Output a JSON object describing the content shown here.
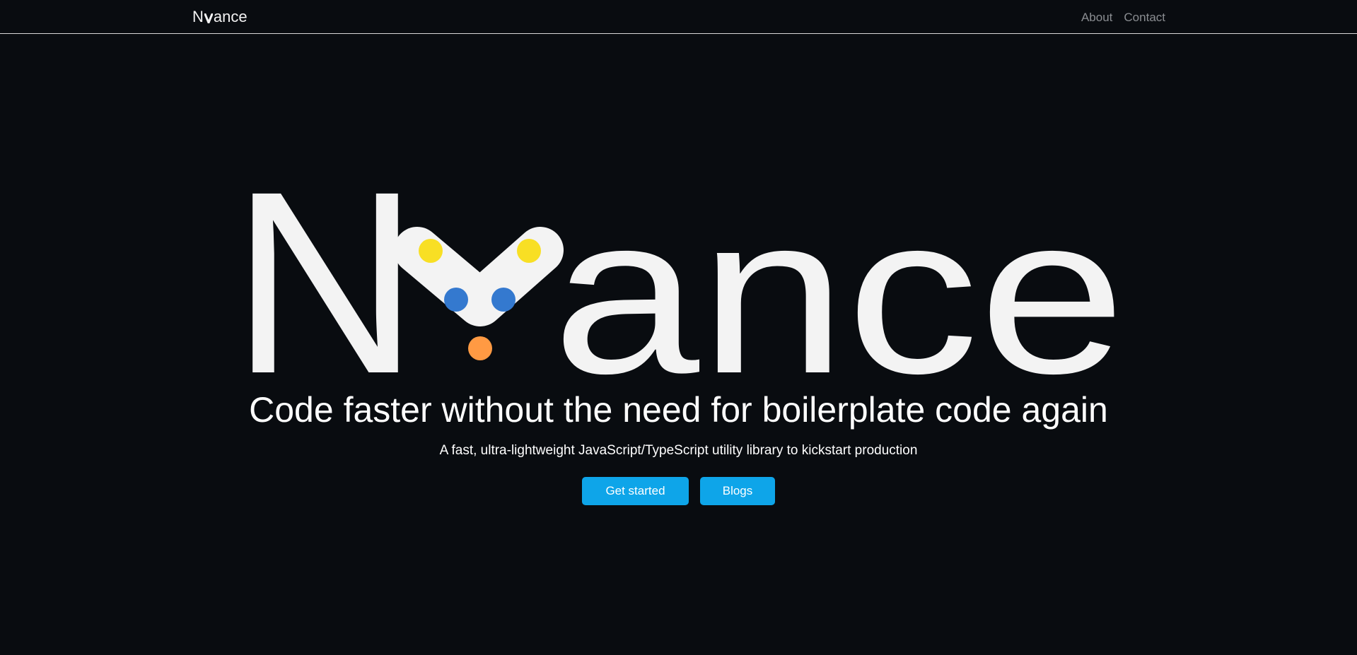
{
  "nav": {
    "logo_prefix": "N",
    "logo_suffix": "ance",
    "links": [
      {
        "label": "About"
      },
      {
        "label": "Contact"
      }
    ]
  },
  "hero": {
    "logo_prefix": "N",
    "logo_suffix": "ance",
    "logo_dot_colors": {
      "yellow": "#f8df24",
      "blue": "#3479cf",
      "orange": "#ff9a43"
    },
    "tagline": "Code faster without the need for boilerplate code again",
    "subtitle": "A fast, ultra-lightweight JavaScript/TypeScript utility library to kickstart production",
    "buttons": {
      "primary": "Get started",
      "secondary": "Blogs"
    }
  },
  "colors": {
    "background": "#090c10",
    "accent": "#0ea5e9",
    "text": "#ffffff",
    "muted": "#8a8d91"
  }
}
